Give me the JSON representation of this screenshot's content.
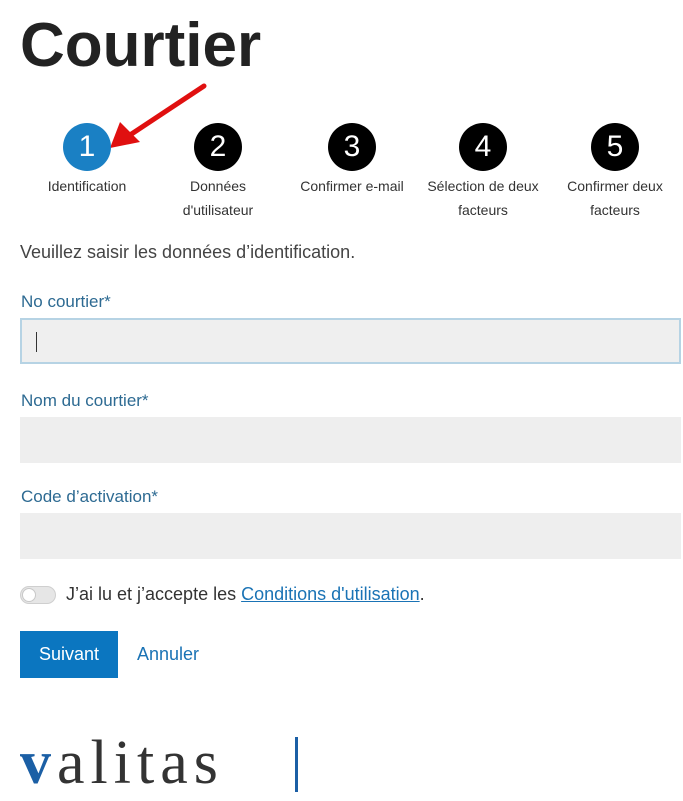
{
  "page": {
    "title": "Courtier"
  },
  "steps": [
    {
      "number": "1",
      "label": "Identification",
      "active": true
    },
    {
      "number": "2",
      "label": "Données d'utilisateur",
      "active": false
    },
    {
      "number": "3",
      "label": "Confirmer e-mail",
      "active": false
    },
    {
      "number": "4",
      "label": "Sélection de deux facteurs",
      "active": false
    },
    {
      "number": "5",
      "label": "Confirmer deux facteurs",
      "active": false
    }
  ],
  "form": {
    "intro": "Veuillez saisir les données d’identification.",
    "fields": [
      {
        "label": "No courtier*",
        "value": ""
      },
      {
        "label": "Nom du courtier*",
        "value": ""
      },
      {
        "label": "Code d’activation*",
        "value": ""
      }
    ],
    "terms_prefix": "J’ai lu et j’accepte les ",
    "terms_link": "Conditions d'utilisation",
    "terms_suffix": ".",
    "terms_accepted": false
  },
  "actions": {
    "next": "Suivant",
    "cancel": "Annuler"
  },
  "brand": {
    "logo_v": "v",
    "logo_rest": "alitas"
  },
  "colors": {
    "accent": "#1a80c4",
    "label": "#2d6a92",
    "arrow": "#e01010",
    "link": "#1a73b5"
  }
}
